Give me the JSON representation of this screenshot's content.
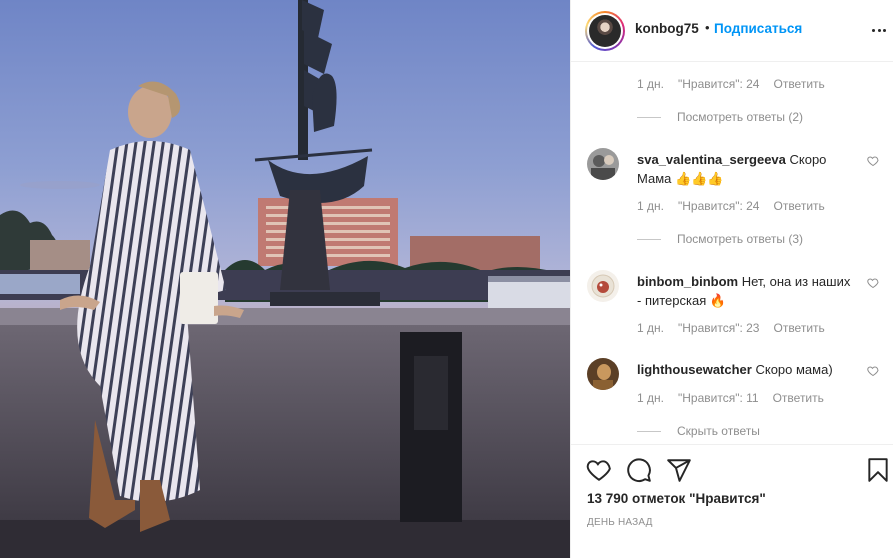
{
  "post": {
    "author": "konbog75",
    "separator": "•",
    "follow_label": "Подписаться"
  },
  "comments_section": {
    "top_meta": {
      "age": "1 дн.",
      "likes": "\"Нравится\": 24",
      "reply": "Ответить"
    },
    "top_replies": "Посмотреть ответы (2)",
    "items": [
      {
        "username": "sva_valentina_sergeeva",
        "text": " Скоро Мама 👍👍👍",
        "age": "1 дн.",
        "likes": "\"Нравится\": 24",
        "reply": "Ответить",
        "replies": "Посмотреть ответы (3)"
      },
      {
        "username": "binbom_binbom",
        "text": " Нет, она из наших - питерская 🔥",
        "age": "1 дн.",
        "likes": "\"Нравится\": 23",
        "reply": "Ответить"
      },
      {
        "username": "lighthousewatcher",
        "text": " Скоро мама)",
        "age": "1 дн.",
        "likes": "\"Нравится\": 11",
        "reply": "Ответить",
        "replies": "Скрыть ответы"
      }
    ]
  },
  "actions": {
    "like_icon": "heart-icon",
    "comment_icon": "comment-icon",
    "share_icon": "share-icon",
    "save_icon": "bookmark-icon",
    "likes_total": "13 790 отметок \"Нравится\"",
    "date": "День назад"
  },
  "colors": {
    "link": "#0095f6",
    "muted": "#8e8e8e",
    "text": "#262626"
  }
}
